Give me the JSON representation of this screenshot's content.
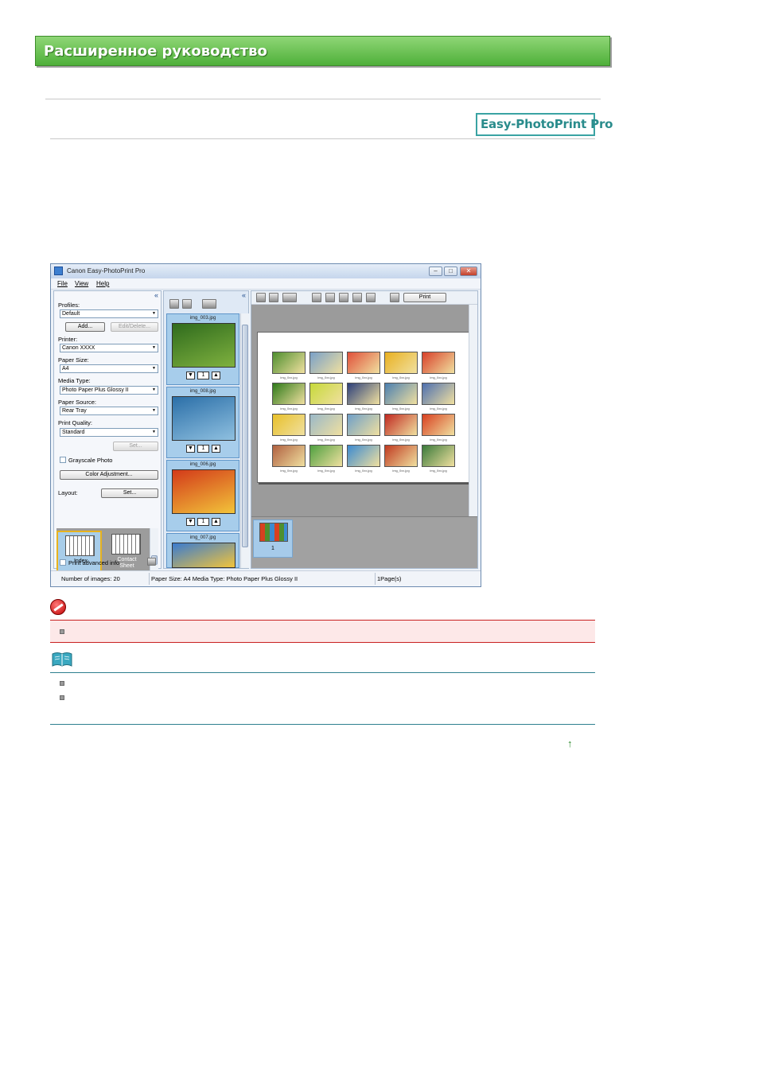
{
  "page": {
    "banner_title": "Расширенное руководство",
    "product_logo": "Easy-PhotoPrint Pro",
    "top_link_label": "↑"
  },
  "window": {
    "title": "Canon Easy-PhotoPrint Pro",
    "controls": {
      "minimize": "–",
      "maximize": "□",
      "close": "✕"
    },
    "menu": [
      "File",
      "View",
      "Help"
    ],
    "left_panel": {
      "collapse_label": "«",
      "profiles_label": "Profiles:",
      "profiles_value": "Default",
      "add_button": "Add...",
      "edit_delete_button": "Edit/Delete...",
      "printer_label": "Printer:",
      "printer_value": "Canon XXXX",
      "paper_size_label": "Paper Size:",
      "paper_size_value": "A4",
      "media_type_label": "Media Type:",
      "media_type_value": "Photo Paper Plus Glossy II",
      "paper_source_label": "Paper Source:",
      "paper_source_value": "Rear Tray",
      "print_quality_label": "Print Quality:",
      "print_quality_value": "Standard",
      "set_button": "Set...",
      "grayscale_label": "Grayscale Photo",
      "color_adjustment_button": "Color Adjustment...",
      "layout_label": "Layout:",
      "layout_set_button": "Set...",
      "layouts": [
        {
          "label": "Index",
          "selected": true
        },
        {
          "label": "Contact Sheet",
          "selected": false
        }
      ],
      "print_advanced_label": "Print advanced info"
    },
    "middle_panel": {
      "collapse_label": "«",
      "photos": [
        {
          "file": "img_003.jpg",
          "copies": "1",
          "colors": [
            "#2f6b1d",
            "#7fb13f"
          ]
        },
        {
          "file": "img_008.jpg",
          "copies": "1",
          "colors": [
            "#2b6fa8",
            "#8fc0e0"
          ]
        },
        {
          "file": "img_006.jpg",
          "copies": "1",
          "colors": [
            "#d33a1a",
            "#f2c43a"
          ]
        },
        {
          "file": "img_007.jpg",
          "copies": "",
          "colors": [
            "#3a7bd0",
            "#f2c43a"
          ]
        }
      ]
    },
    "right_panel": {
      "print_button": "Print",
      "index_tile_colors": [
        "#4f8f2f",
        "#7aa0c8",
        "#e0503a",
        "#e9b020",
        "#d8402a",
        "#2f7a1a",
        "#c6d93a",
        "#2c3f7a",
        "#4b7fb0",
        "#4d6fb0",
        "#e8c02a",
        "#9ab8c8",
        "#6f9fc8",
        "#c02820",
        "#d84020",
        "#b06040",
        "#4fa040",
        "#3c8ad0",
        "#c03a20",
        "#3a7a3a"
      ],
      "tile_caption": "img_0xx.jpg",
      "page_numbers": [
        "1"
      ]
    },
    "status": {
      "images": "Number of images: 20",
      "paper_info": "Paper Size: A4  Media Type: Photo Paper Plus Glossy II",
      "pages": "1Page(s)"
    }
  }
}
